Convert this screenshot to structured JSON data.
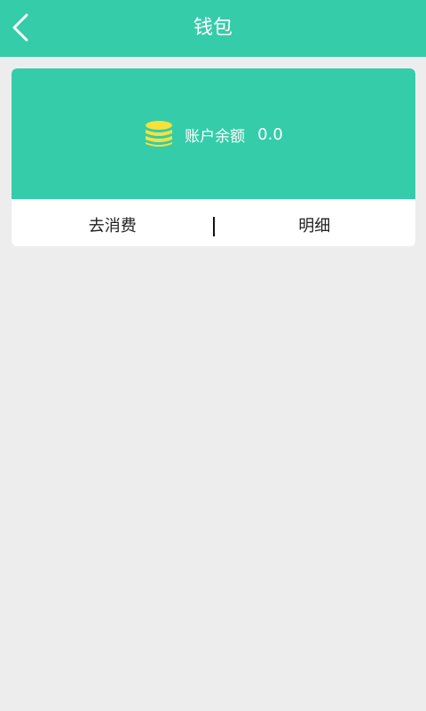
{
  "header": {
    "title": "钱包",
    "back_icon": "chevron-left-icon"
  },
  "wallet": {
    "balance_label": "账户余额",
    "balance_value": "0.0",
    "coin_icon": "coin-stack-icon"
  },
  "actions": {
    "spend_label": "去消费",
    "detail_label": "明细"
  },
  "colors": {
    "primary": "#35cca9",
    "coin": "#f7e13a",
    "background": "#ededed"
  }
}
